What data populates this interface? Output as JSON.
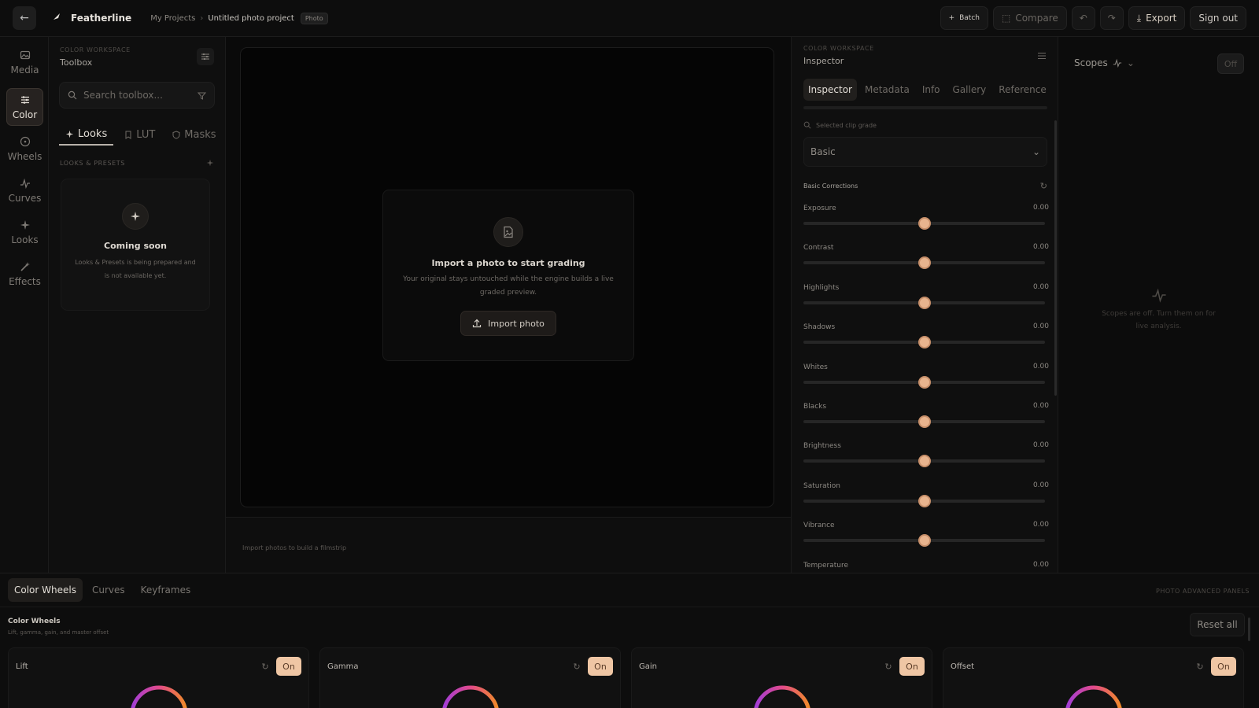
{
  "topbar": {
    "back_label": "Back",
    "brand": "Featherline",
    "breadcrumb_root": "My Projects",
    "breadcrumb_current": "Untitled photo project",
    "badge": "Photo",
    "batch": "Batch",
    "compare": "Compare",
    "export": "Export",
    "sign_out": "Sign out"
  },
  "rail": {
    "items": [
      {
        "label": "Media",
        "icon": "image-icon"
      },
      {
        "label": "Color",
        "icon": "sliders-icon"
      },
      {
        "label": "Wheels",
        "icon": "circle-icon"
      },
      {
        "label": "Curves",
        "icon": "pulse-icon"
      },
      {
        "label": "Looks",
        "icon": "sparkle-icon"
      },
      {
        "label": "Effects",
        "icon": "wand-icon"
      }
    ]
  },
  "toolbox": {
    "eyebrow": "COLOR WORKSPACE",
    "title": "Toolbox",
    "search_placeholder": "Search toolbox...",
    "tabs": [
      "Looks",
      "LUT",
      "Masks"
    ],
    "section": "LOOKS & PRESETS",
    "coming_title": "Coming soon",
    "coming_text": "Looks & Presets is being prepared and is not available yet."
  },
  "canvas": {
    "import_title": "Import a photo to start grading",
    "import_text": "Your original stays untouched while the engine builds a live graded preview.",
    "import_button": "Import photo",
    "filmstrip_text": "Import photos to build a filmstrip"
  },
  "inspector": {
    "eyebrow": "COLOR WORKSPACE",
    "title": "Inspector",
    "tabs": [
      "Inspector",
      "Metadata",
      "Info",
      "Gallery",
      "Reference"
    ],
    "selected_label": "Selected clip grade",
    "mode": "Basic",
    "section": "Basic Corrections",
    "sliders": [
      {
        "label": "Exposure",
        "value": "0.00",
        "position": 0.5
      },
      {
        "label": "Contrast",
        "value": "0.00",
        "position": 0.5
      },
      {
        "label": "Highlights",
        "value": "0.00",
        "position": 0.5
      },
      {
        "label": "Shadows",
        "value": "0.00",
        "position": 0.5
      },
      {
        "label": "Whites",
        "value": "0.00",
        "position": 0.5
      },
      {
        "label": "Blacks",
        "value": "0.00",
        "position": 0.5
      },
      {
        "label": "Brightness",
        "value": "0.00",
        "position": 0.5
      },
      {
        "label": "Saturation",
        "value": "0.00",
        "position": 0.5
      },
      {
        "label": "Vibrance",
        "value": "0.00",
        "position": 0.5
      },
      {
        "label": "Temperature",
        "value": "0.00",
        "position": 0.5
      }
    ]
  },
  "scopes": {
    "title": "Scopes",
    "toggle": "Off",
    "empty_text": "Scopes are off. Turn them on for live analysis."
  },
  "bottom": {
    "tabs": [
      "Color Wheels",
      "Curves",
      "Keyframes"
    ],
    "right_label": "PHOTO ADVANCED PANELS",
    "title": "Color Wheels",
    "subtitle": "Lift, gamma, gain, and master offset",
    "reset_all": "Reset all",
    "wheels": [
      {
        "label": "Lift",
        "toggle": "On"
      },
      {
        "label": "Gamma",
        "toggle": "On"
      },
      {
        "label": "Gain",
        "toggle": "On"
      },
      {
        "label": "Offset",
        "toggle": "On"
      }
    ]
  },
  "colors": {
    "accent": "#e8b48e",
    "toggle_on": "#efc6a4"
  }
}
